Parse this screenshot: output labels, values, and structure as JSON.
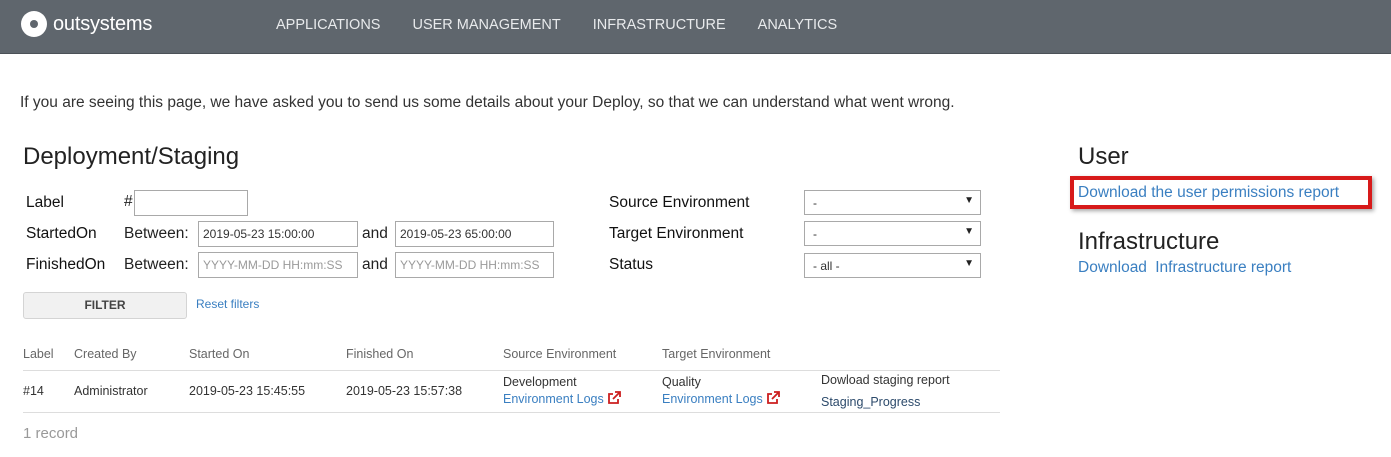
{
  "brand": {
    "name": "outsystems"
  },
  "nav": [
    "APPLICATIONS",
    "USER MANAGEMENT",
    "INFRASTRUCTURE",
    "ANALYTICS"
  ],
  "intro": "If you are seeing this page, we have asked you to send us some details about your Deploy, so that we can understand what went wrong.",
  "deploy": {
    "title": "Deployment/Staging",
    "label_label": "Label",
    "hash": "#",
    "label_value": "",
    "started_label": "StartedOn",
    "finished_label": "FinishedOn",
    "between": "Between:",
    "and": "and",
    "started_from": "2019-05-23 15:00:00",
    "started_to": "2019-05-23 65:00:00",
    "finished_placeholder": "YYYY-MM-DD HH:mm:SS",
    "source_env_label": "Source Environment",
    "target_env_label": "Target Environment",
    "status_label": "Status",
    "source_env_value": "-",
    "target_env_value": "-",
    "status_value": "- all -",
    "filter_button": "FILTER",
    "reset_filters": "Reset filters"
  },
  "table": {
    "headers": [
      "Label",
      "Created By",
      "Started On",
      "Finished On",
      "Source Environment",
      "Target Environment"
    ],
    "rows": [
      {
        "label": "#14",
        "created_by": "Administrator",
        "started_on": "2019-05-23 15:45:55",
        "finished_on": "2019-05-23 15:57:38",
        "source_env": "Development",
        "source_logs": "Environment Logs",
        "target_env": "Quality",
        "target_logs": "Environment Logs",
        "download_report": "Dowload staging report",
        "progress": "Staging_Progress"
      }
    ],
    "record_count": "1 record"
  },
  "user": {
    "title": "User",
    "download_link": "Download the user permissions report"
  },
  "infrastructure": {
    "title": "Infrastructure",
    "download": "Download",
    "report": "Infrastructure report"
  },
  "colors": {
    "topbar": "#5f666d",
    "link": "#3a7fc1",
    "highlight": "#d71a1a",
    "external_icon": "#cc1f1f"
  },
  "icons": {
    "external_link": "external-link-icon"
  }
}
